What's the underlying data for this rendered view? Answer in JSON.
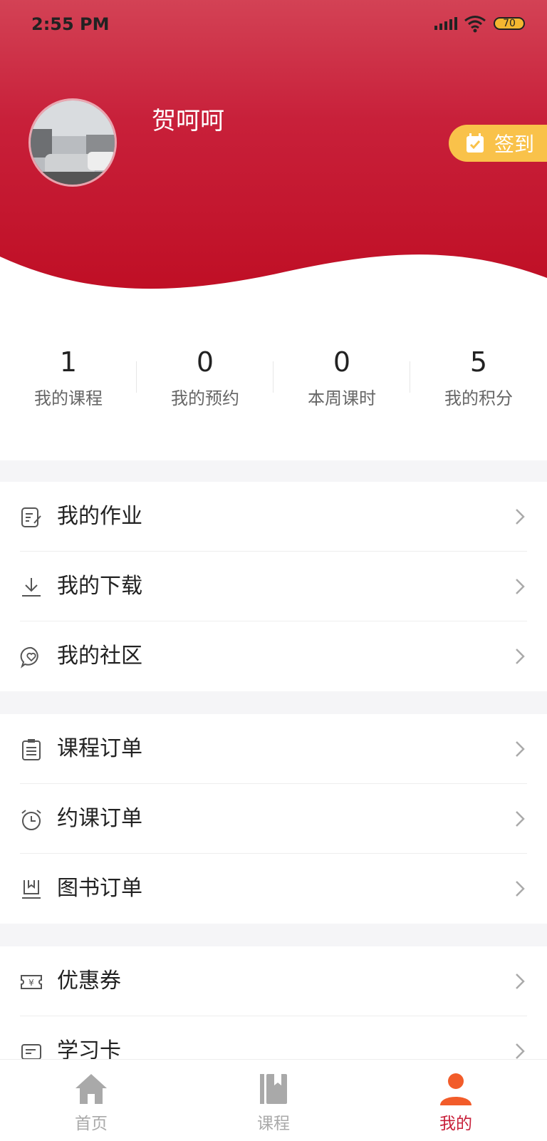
{
  "status_bar": {
    "time": "2:55 PM",
    "battery": "70"
  },
  "profile": {
    "username": "贺呵呵",
    "checkin_label": "签到"
  },
  "stats": [
    {
      "value": "1",
      "label": "我的课程"
    },
    {
      "value": "0",
      "label": "我的预约"
    },
    {
      "value": "0",
      "label": "本周课时"
    },
    {
      "value": "5",
      "label": "我的积分"
    }
  ],
  "menu_groups": [
    [
      {
        "label": "我的作业",
        "icon": "homework-icon"
      },
      {
        "label": "我的下载",
        "icon": "download-icon"
      },
      {
        "label": "我的社区",
        "icon": "community-icon"
      }
    ],
    [
      {
        "label": "课程订单",
        "icon": "course-order-icon"
      },
      {
        "label": "约课订单",
        "icon": "alarm-clock-icon"
      },
      {
        "label": "图书订单",
        "icon": "book-order-icon"
      }
    ],
    [
      {
        "label": "优惠券",
        "icon": "coupon-icon"
      },
      {
        "label": "学习卡",
        "icon": "study-card-icon"
      }
    ]
  ],
  "tabbar": {
    "items": [
      {
        "label": "首页",
        "icon": "home-icon"
      },
      {
        "label": "课程",
        "icon": "book-icon"
      },
      {
        "label": "我的",
        "icon": "user-icon"
      }
    ],
    "active": "我的"
  },
  "colors": {
    "brand": "#c8203a",
    "checkin": "#f9c24a",
    "text": "#222222",
    "muted": "#aaaaaa"
  }
}
